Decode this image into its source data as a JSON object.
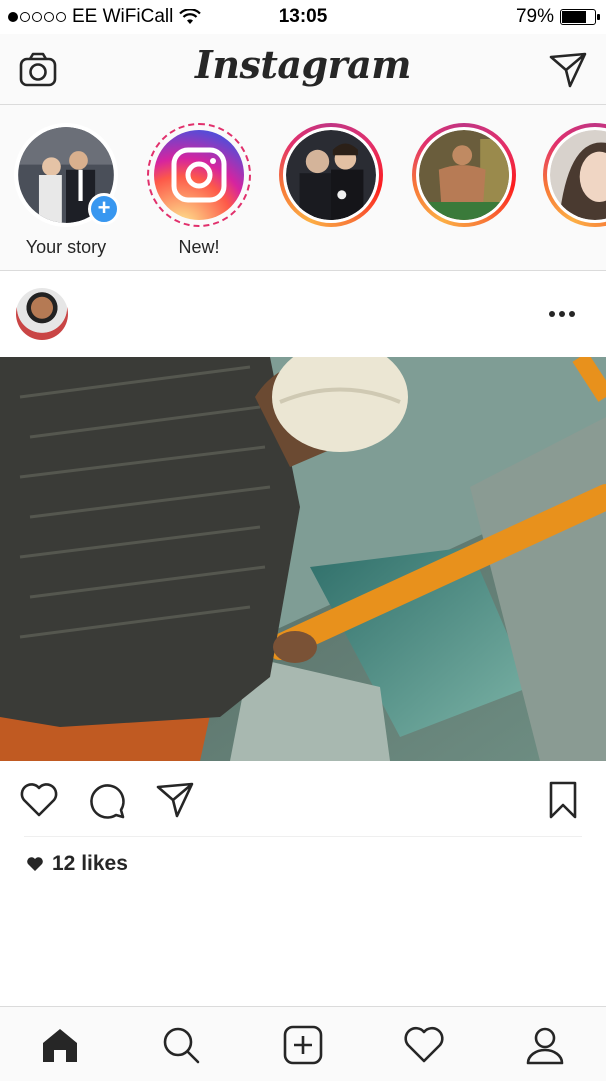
{
  "status_bar": {
    "signal_dots_filled": 1,
    "signal_dots_total": 5,
    "carrier": "EE WiFiCall",
    "time": "13:05",
    "battery_percent": "79%",
    "battery_level": 0.79
  },
  "header": {
    "logo_text": "Instagram",
    "left_icon": "camera-icon",
    "right_icon": "direct-message-icon"
  },
  "stories": [
    {
      "label": "Your story",
      "type": "own",
      "badge": "+"
    },
    {
      "label": "New!",
      "type": "new"
    },
    {
      "label": "",
      "type": "user"
    },
    {
      "label": "",
      "type": "user"
    },
    {
      "label": "",
      "type": "user"
    }
  ],
  "post": {
    "more_icon": "more-options-icon",
    "likes_text": "12 likes"
  },
  "actions": {
    "like_icon": "heart-icon",
    "comment_icon": "comment-icon",
    "share_icon": "share-icon",
    "save_icon": "bookmark-icon"
  },
  "tabbar": {
    "items": [
      "home-icon",
      "search-icon",
      "add-post-icon",
      "activity-heart-icon",
      "profile-icon"
    ]
  },
  "colors": {
    "accent_blue": "#3897f0",
    "text": "#262626",
    "divider": "#dbdbdb"
  }
}
